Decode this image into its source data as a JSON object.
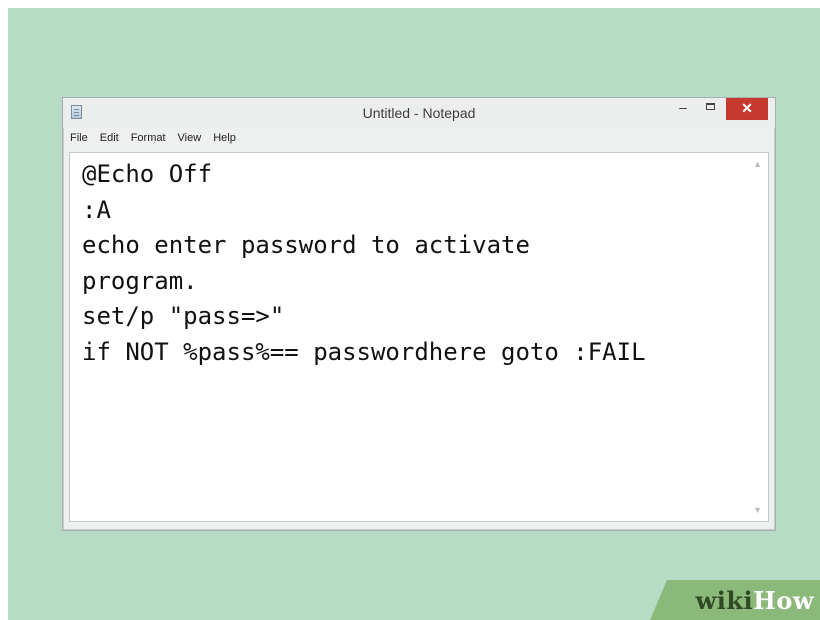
{
  "window": {
    "title": "Untitled - Notepad",
    "controls": {
      "minimize": "–",
      "close": "✕"
    }
  },
  "menu": [
    {
      "label": "File"
    },
    {
      "label": "Edit"
    },
    {
      "label": "Format"
    },
    {
      "label": "View"
    },
    {
      "label": "Help"
    }
  ],
  "editor": {
    "lines": [
      "@Echo Off",
      ":A",
      "echo enter password to activate",
      "program.",
      "set/p \"pass=>\"",
      "if NOT %pass%== passwordhere goto :FAIL"
    ]
  },
  "watermark": {
    "wiki": "wiki",
    "how": "How"
  },
  "colors": {
    "background": "#b6dcc6",
    "close_button": "#c7382f",
    "watermark_bg": "#8bb97a"
  },
  "icons": [
    "notepad-icon",
    "minimize-icon",
    "maximize-icon",
    "close-icon",
    "scroll-up-arrow-icon",
    "scroll-down-arrow-icon"
  ]
}
